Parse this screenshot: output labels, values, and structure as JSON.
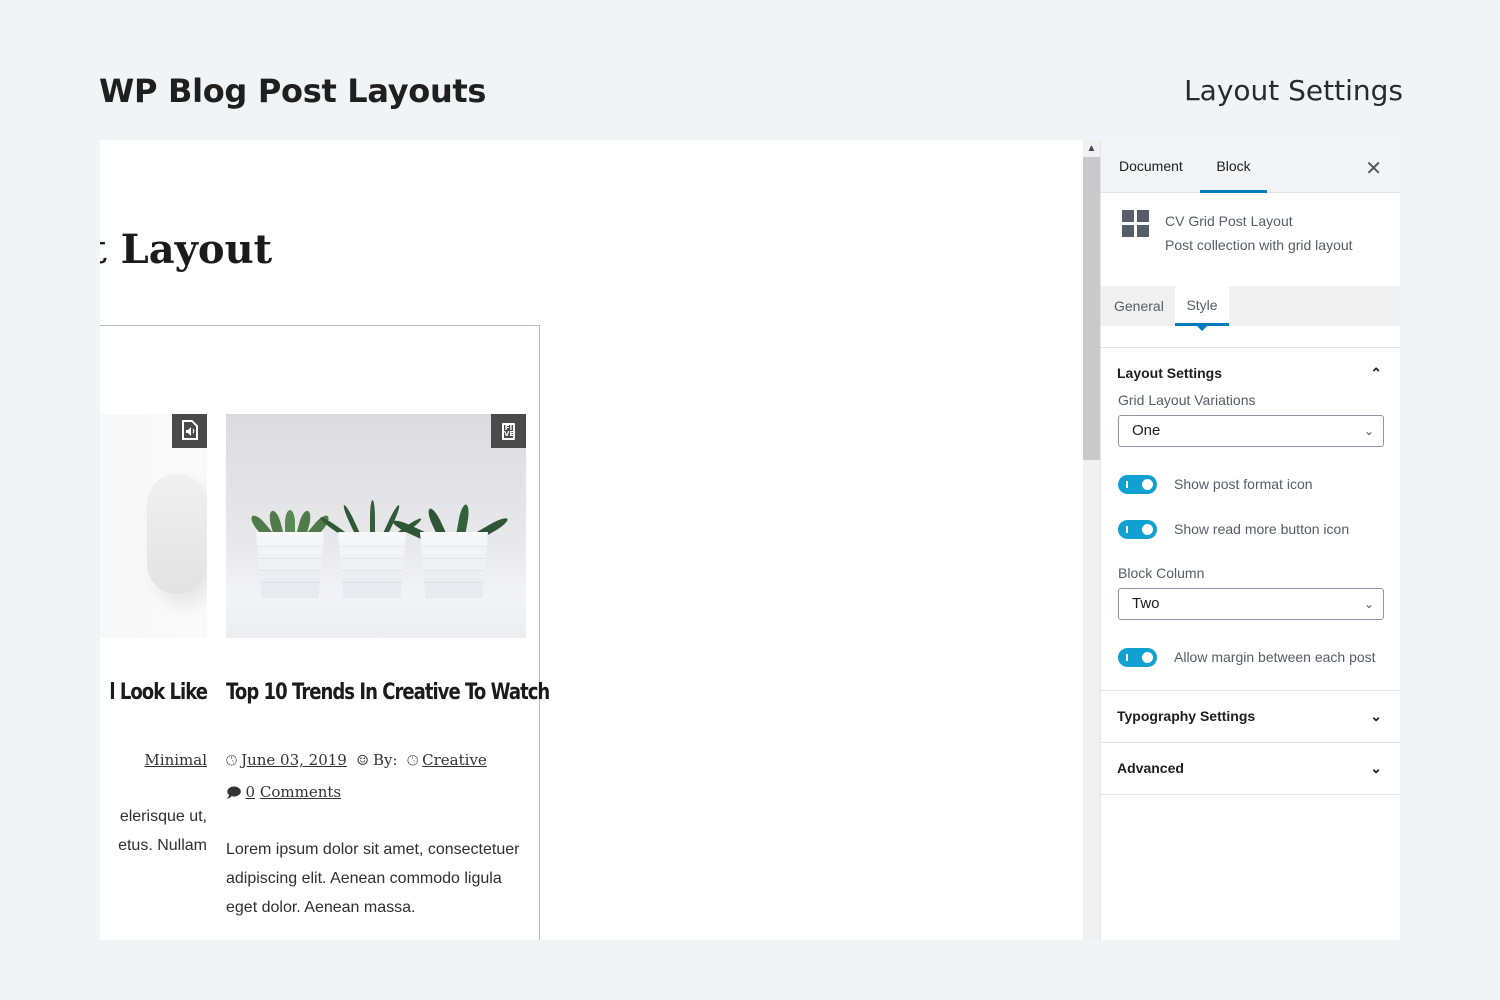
{
  "header": {
    "title": "WP Blog Post Layouts",
    "section": "Layout Settings"
  },
  "editor": {
    "post_title_partial": "Post Layout",
    "block_heading_partial": "t",
    "posts": [
      {
        "title_partial": "l Look Like",
        "meta_category": "Minimal",
        "excerpt_lines": [
          "elerisque ut,",
          "etus. Nullam"
        ],
        "format_icon": "audio-file-icon"
      },
      {
        "title": "Top 10 Trends In Creative To Watch",
        "date": "June 03, 2019",
        "by_label": "By:",
        "category": "Creative",
        "comments_count": "0",
        "comments_label": "Comments",
        "excerpt": "Lorem ipsum dolor sit amet, consectetuer adipiscing elit. Aenean commodo ligula eget dolor. Aenean massa.",
        "format_icon": "gallery-icon",
        "format_glyph": "FI VE"
      }
    ]
  },
  "sidebar": {
    "tabs": [
      {
        "label": "Document"
      },
      {
        "label": "Block",
        "active": true
      }
    ],
    "close_label": "✕",
    "block": {
      "name": "CV Grid Post Layout",
      "description": "Post collection with grid layout"
    },
    "panel_tabs": [
      {
        "label": "General"
      },
      {
        "label": "Style",
        "active": true
      }
    ],
    "layout_settings": {
      "title": "Layout Settings",
      "expanded": true,
      "grid_variation_label": "Grid Layout Variations",
      "grid_variation_value": "One",
      "toggles": [
        {
          "label": "Show post format icon",
          "on": true
        },
        {
          "label": "Show read more button icon",
          "on": true
        }
      ],
      "block_column_label": "Block Column",
      "block_column_value": "Two",
      "margin_toggle": {
        "label": "Allow margin between each post",
        "on": true
      }
    },
    "typography": {
      "title": "Typography Settings",
      "expanded": false
    },
    "advanced": {
      "title": "Advanced",
      "expanded": false
    }
  },
  "colors": {
    "accent": "#007cba",
    "toggle_on": "#11a0d2"
  }
}
